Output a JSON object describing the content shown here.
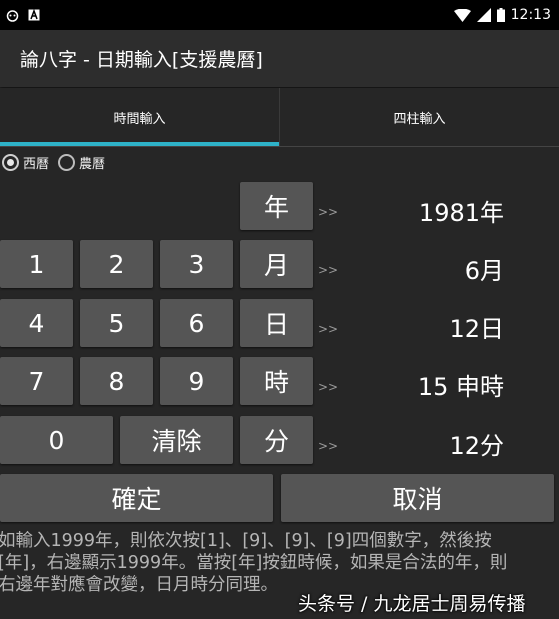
{
  "status_bar": {
    "left_icons": [
      "android-debug-icon",
      "text-a-icon"
    ],
    "right_icons": [
      "wifi-icon",
      "cell-signal-icon",
      "battery-icon"
    ],
    "time": "12:13"
  },
  "app": {
    "title": "論八字 - 日期輸入[支援農曆]"
  },
  "tabs": [
    {
      "label": "時間輸入",
      "active": true
    },
    {
      "label": "四柱輸入",
      "active": false
    }
  ],
  "calendar_mode": {
    "options": [
      {
        "label": "西曆",
        "checked": true
      },
      {
        "label": "農曆",
        "checked": false
      }
    ]
  },
  "keypad": {
    "digits": [
      "1",
      "2",
      "3",
      "4",
      "5",
      "6",
      "7",
      "8",
      "9",
      "0"
    ],
    "clear_label": "清除"
  },
  "fields": [
    {
      "unit_label": "年",
      "value": "1981年"
    },
    {
      "unit_label": "月",
      "value": "6月"
    },
    {
      "unit_label": "日",
      "value": "12日"
    },
    {
      "unit_label": "時",
      "value": "15 申時"
    },
    {
      "unit_label": "分",
      "value": "12分"
    }
  ],
  "arrow_glyph": ">>",
  "actions": {
    "confirm_label": "確定",
    "cancel_label": "取消"
  },
  "help_text": "如輸入1999年，則依次按[1]、[9]、[9]、[9]四個數字，然後按\n[年]，右邊顯示1999年。當按[年]按鈕時候，如果是合法的年，則\n右邊年對應會改變，日月時分同理。",
  "watermark": "头条号 / 九龙居士周易传播",
  "colors": {
    "accent": "#2eb2c8",
    "background": "#262626",
    "key": "#555555",
    "appbar": "#2d2d2d"
  }
}
